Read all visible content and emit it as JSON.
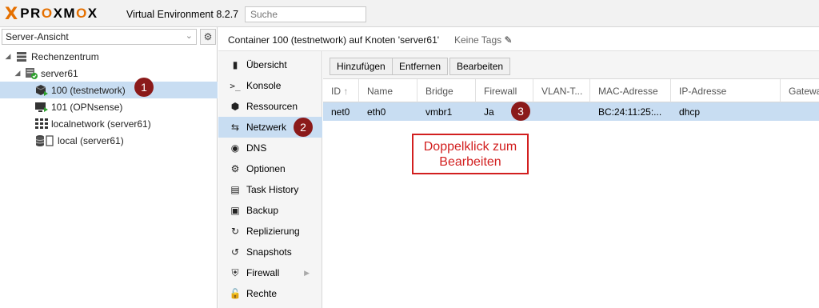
{
  "topbar": {
    "logo_x": "X",
    "logo_text_a": "PR",
    "logo_text_o": "O",
    "logo_text_b": "XM",
    "logo_text_o2": "O",
    "logo_text_c": "X",
    "version": "Virtual Environment 8.2.7",
    "search_placeholder": "Suche"
  },
  "left": {
    "view_select": "Server-Ansicht",
    "tree": [
      {
        "label": "Rechenzentrum",
        "icon": "datacenter-icon"
      },
      {
        "label": "server61",
        "icon": "server-online-icon"
      },
      {
        "label": "100 (testnetwork)",
        "icon": "container-running-icon"
      },
      {
        "label": "101 (OPNsense)",
        "icon": "vm-running-icon"
      },
      {
        "label": "localnetwork (server61)",
        "icon": "sdn-zone-icon"
      },
      {
        "label": "local (server61)",
        "icon": "storage-icon"
      }
    ]
  },
  "header": {
    "title": "Container 100 (testnetwork) auf Knoten 'server61'",
    "tags": "Keine Tags"
  },
  "nav": [
    {
      "label": "Übersicht",
      "icon": "book-icon"
    },
    {
      "label": "Konsole",
      "icon": "terminal-icon"
    },
    {
      "label": "Ressourcen",
      "icon": "cube-icon"
    },
    {
      "label": "Netzwerk",
      "icon": "exchange-icon"
    },
    {
      "label": "DNS",
      "icon": "globe-icon"
    },
    {
      "label": "Optionen",
      "icon": "gear-icon"
    },
    {
      "label": "Task History",
      "icon": "list-icon"
    },
    {
      "label": "Backup",
      "icon": "floppy-icon"
    },
    {
      "label": "Replizierung",
      "icon": "retweet-icon"
    },
    {
      "label": "Snapshots",
      "icon": "history-icon"
    },
    {
      "label": "Firewall",
      "icon": "shield-icon"
    },
    {
      "label": "Rechte",
      "icon": "unlock-icon"
    }
  ],
  "toolbar": {
    "add": "Hinzufügen",
    "remove": "Entfernen",
    "edit": "Bearbeiten"
  },
  "grid": {
    "columns": [
      "ID",
      "Name",
      "Bridge",
      "Firewall",
      "VLAN-T...",
      "MAC-Adresse",
      "IP-Adresse",
      "Gatewa"
    ],
    "sort_indicator": "↑",
    "rows": [
      [
        "net0",
        "eth0",
        "vmbr1",
        "Ja",
        "",
        "BC:24:11:25:...",
        "dhcp",
        ""
      ]
    ]
  },
  "annotations": {
    "badge1": "1",
    "badge2": "2",
    "badge3": "3",
    "note_line1": "Doppelklick zum",
    "note_line2": "Bearbeiten"
  },
  "colors": {
    "accent": "#e57000",
    "selection": "#c8ddf2",
    "badge": "#8b1a1a",
    "annotation": "#d21f1f"
  }
}
